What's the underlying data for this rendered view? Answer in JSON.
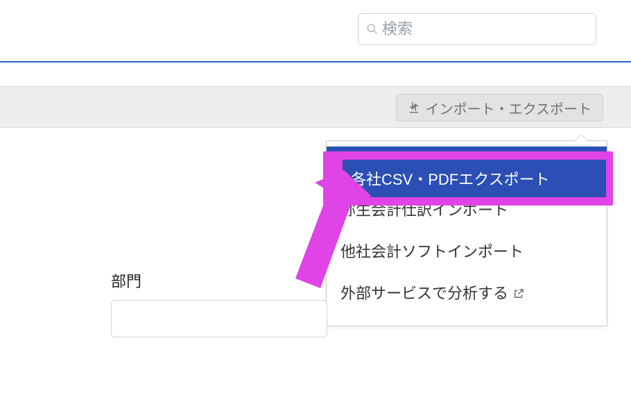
{
  "search": {
    "placeholder": "検索"
  },
  "toolbar": {
    "import_export_label": "インポート・エクスポート"
  },
  "dropdown": {
    "items": [
      {
        "label": "各社CSV・PDFエクスポート",
        "selected": true,
        "external": false
      },
      {
        "label": "弥生会計仕訳インポート",
        "selected": false,
        "external": false
      },
      {
        "label": "他社会計ソフトインポート",
        "selected": false,
        "external": false
      },
      {
        "label": "外部サービスで分析する",
        "selected": false,
        "external": true
      }
    ]
  },
  "form": {
    "field_label": "部門"
  },
  "annotation": {
    "highlight_color": "#e043e6",
    "accent_color": "#2b4fb4"
  }
}
